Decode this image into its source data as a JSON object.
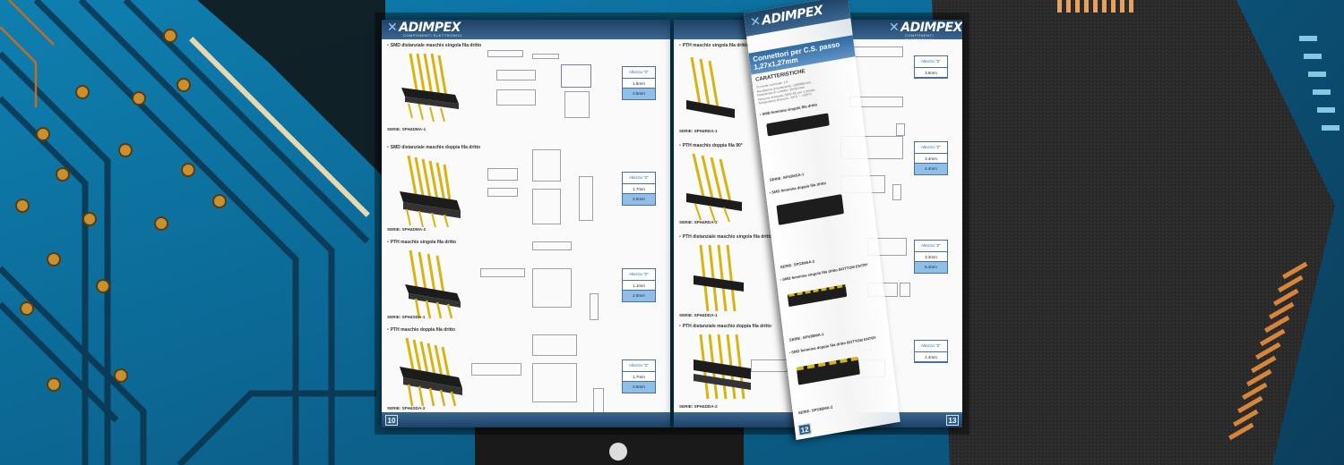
{
  "brand": {
    "name": "ADIMPEX",
    "tagline": "COMPONENTI ELETTRONICI"
  },
  "left_page": {
    "page_number": "10",
    "sections": [
      {
        "title": "SMD distanziale maschio singola fila dritto",
        "serie": "SERIE: SPH4DMA-1",
        "box_header": "Altezza \"Z\"",
        "values": [
          "1.5mm",
          "2.5mm"
        ]
      },
      {
        "title": "SMD distanziale maschio doppia fila dritto",
        "serie": "SERIE: SPH4DMA-2",
        "box_header": "Altezza \"Z\"",
        "values": [
          "1.7mm",
          "2.5mm"
        ]
      },
      {
        "title": "PTH maschio singola fila dritto",
        "serie": "SERIE: SPH4SDA-1",
        "box_header": "Altezza \"Z\"",
        "values": [
          "1.1mm",
          "2.5mm"
        ]
      },
      {
        "title": "PTH maschio doppia fila dritto",
        "serie": "SERIE: SPH4SDA-2",
        "box_header": "Altezza \"Z\"",
        "values": [
          "1.7mm",
          "2.5mm"
        ]
      }
    ]
  },
  "right_page": {
    "page_number": "13",
    "sections": [
      {
        "title": "PTH maschio singola fila dritto",
        "serie": "SERIE: SPH4RDA-1"
      },
      {
        "title": "PTH maschio doppia fila 90°",
        "serie": "SERIE: SPH4RDA-2"
      },
      {
        "title": "PTH distanziale maschio singola fila dritto",
        "serie": "SERIE: SPH4DDA-1"
      },
      {
        "title": "PTH distanziale maschio doppia fila dritto",
        "serie": "SERIE: SPH4DDA-2"
      }
    ],
    "boxes": [
      {
        "header": "Altezza \"Z\"",
        "values": [
          "3.5mm"
        ]
      },
      {
        "header": "Altezza \"Z\"",
        "values": [
          "3.4mm",
          "4.4mm"
        ]
      },
      {
        "header": "Altezza \"Z\"",
        "values": [
          "3.4mm",
          "5.4mm"
        ]
      },
      {
        "header": "Altezza \"Z\"",
        "values": [
          "4.4mm"
        ]
      }
    ]
  },
  "flipping_page": {
    "page_number": "12",
    "title": "Connettori per C.S. passo 1,27x1,27mm",
    "characteristics_label": "CARATTERISTICHE",
    "specs": [
      "Corrente nominale: 1 A",
      "Resistenza di isolamento: 1000MΩ min.",
      "Resistenza di contatto: 20mΩ max.",
      "Tensione di tenuta: 500V AC per 1 minuto",
      "Temperatura di lavoro: -40°C ~ +105°C"
    ],
    "sections": [
      {
        "title": "SMD femmina singola fila dritto",
        "serie": "SERIE: SPS3MSA-1"
      },
      {
        "title": "SMD femmina doppia fila dritto",
        "serie": "SERIE: SPS3MSA-2"
      },
      {
        "title": "SMD femmina singola fila dritto BOTTOM ENTRY",
        "serie": "SERIE: SPS3BMA-1"
      },
      {
        "title": "SMD femmina doppia fila dritto BOTTOM ENTRY",
        "serie": "SERIE: SPS3BMA-2"
      }
    ]
  },
  "colors": {
    "accent": "#2d5d8b",
    "header_band": "#1d4166",
    "value_fill": "#8fbfe6",
    "pin_gold": "#e8c51a"
  }
}
